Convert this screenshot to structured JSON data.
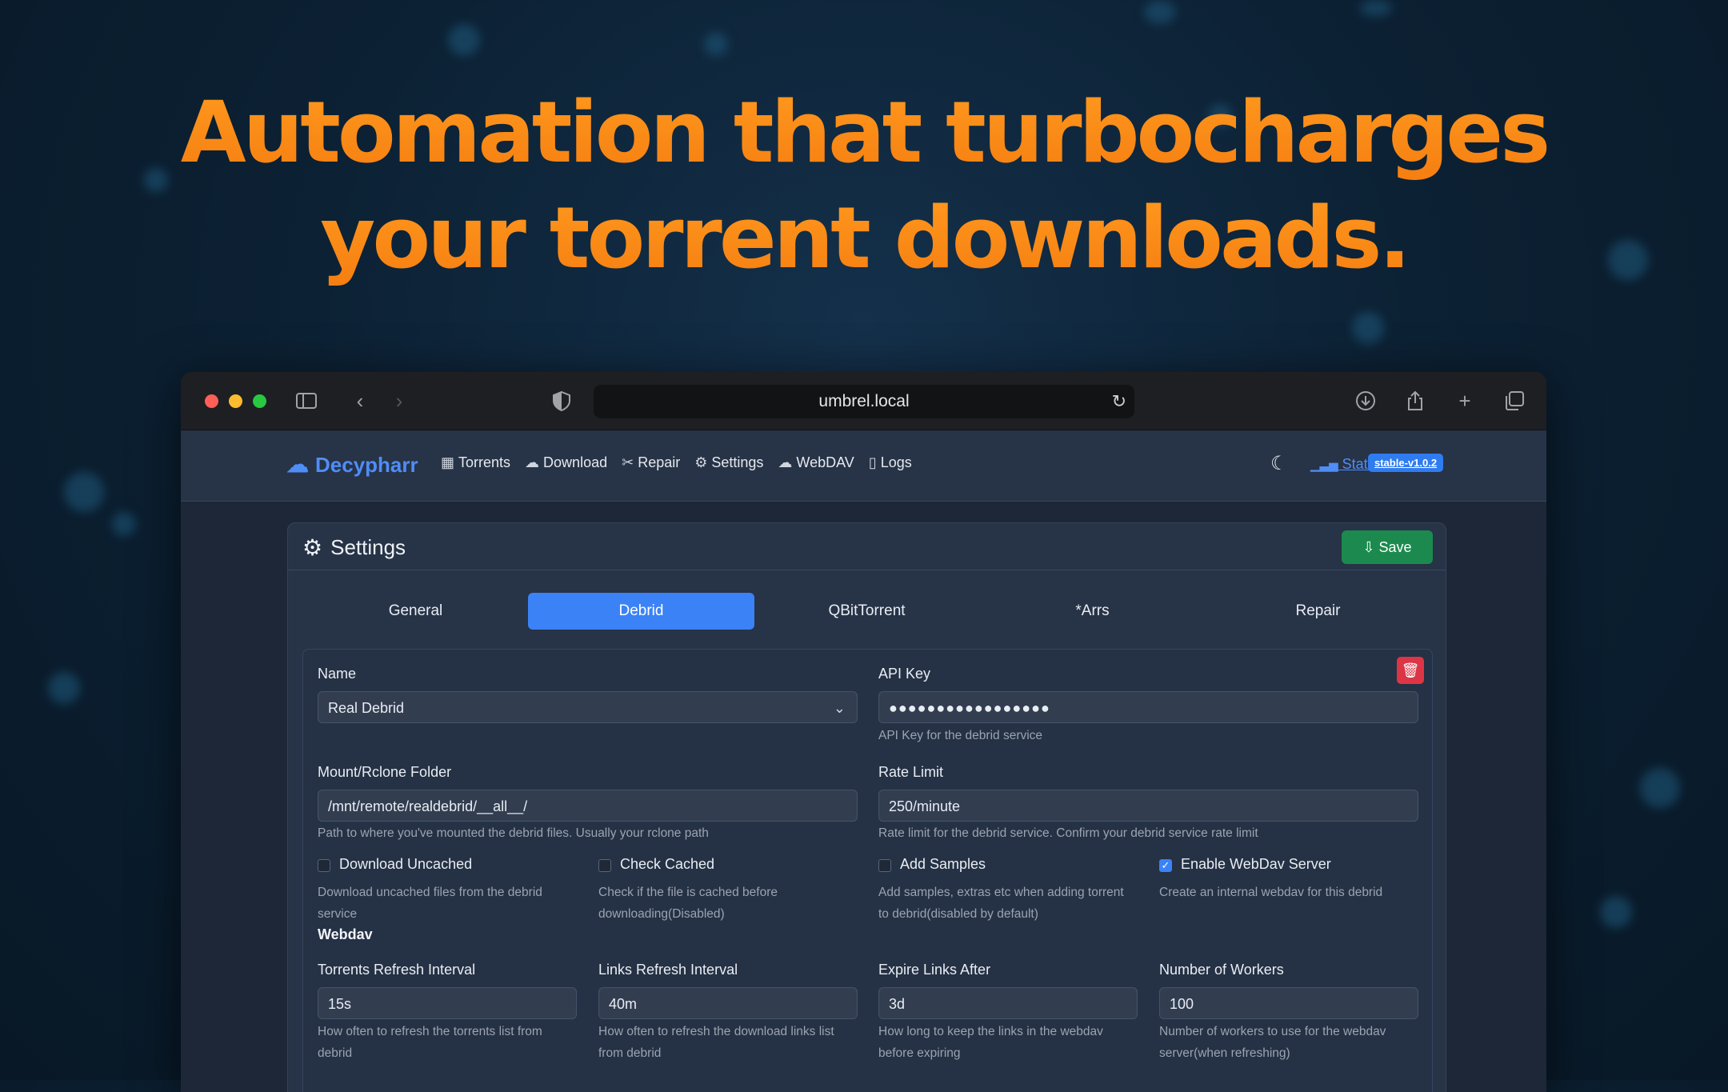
{
  "hero": {
    "line1": "Automation that turbocharges",
    "line2": "your torrent downloads."
  },
  "browser": {
    "url": "umbrel.local",
    "icons": [
      "sidebar-icon",
      "back-icon",
      "forward-icon",
      "shield-icon",
      "reload-icon",
      "download-icon",
      "share-icon",
      "new-tab-icon",
      "tabs-overview-icon"
    ]
  },
  "app": {
    "brand": "Decypharr",
    "nav": [
      {
        "label": "Torrents",
        "icon": "table-icon"
      },
      {
        "label": "Download",
        "icon": "cloud-download-icon"
      },
      {
        "label": "Repair",
        "icon": "tools-icon"
      },
      {
        "label": "Settings",
        "icon": "gear-icon"
      },
      {
        "label": "WebDAV",
        "icon": "cloud-icon"
      },
      {
        "label": "Logs",
        "icon": "file-icon"
      }
    ],
    "stats_label": "Stats",
    "version": "stable-v1.0.2"
  },
  "settings": {
    "title": "Settings",
    "save_label": "Save",
    "tabs": [
      "General",
      "Debrid",
      "QBitTorrent",
      "*Arrs",
      "Repair"
    ],
    "active_tab": "Debrid",
    "debrid": {
      "name_label": "Name",
      "name_value": "Real Debrid",
      "api_key_label": "API Key",
      "api_key_value": "●●●●●●●●●●●●●●●●●",
      "api_key_hint": "API Key for the debrid service",
      "mount_label": "Mount/Rclone Folder",
      "mount_value": "/mnt/remote/realdebrid/__all__/",
      "mount_hint": "Path to where you've mounted the debrid files. Usually your rclone path",
      "rate_label": "Rate Limit",
      "rate_value": "250/minute",
      "rate_hint": "Rate limit for the debrid service. Confirm your debrid service rate limit",
      "checkboxes": [
        {
          "label": "Download Uncached",
          "checked": false,
          "hint1": "Download uncached files from the debrid",
          "hint2": "service"
        },
        {
          "label": "Check Cached",
          "checked": false,
          "hint1": "Check if the file is cached before",
          "hint2": "downloading(Disabled)"
        },
        {
          "label": "Add Samples",
          "checked": false,
          "hint1": "Add samples, extras etc when adding torrent",
          "hint2": "to debrid(disabled by default)"
        },
        {
          "label": "Enable WebDav Server",
          "checked": true,
          "hint1": "Create an internal webdav for this debrid",
          "hint2": ""
        }
      ],
      "webdav_section": "Webdav",
      "webdav_fields": [
        {
          "label": "Torrents Refresh Interval",
          "value": "15s",
          "hint1": "How often to refresh the torrents list from",
          "hint2": "debrid"
        },
        {
          "label": "Links Refresh Interval",
          "value": "40m",
          "hint1": "How often to refresh the download links list",
          "hint2": "from debrid"
        },
        {
          "label": "Expire Links After",
          "value": "3d",
          "hint1": "How long to keep the links in the webdav",
          "hint2": "before expiring"
        },
        {
          "label": "Number of Workers",
          "value": "100",
          "hint1": "Number of workers to use for the webdav",
          "hint2": "server(when refreshing)"
        }
      ]
    }
  }
}
